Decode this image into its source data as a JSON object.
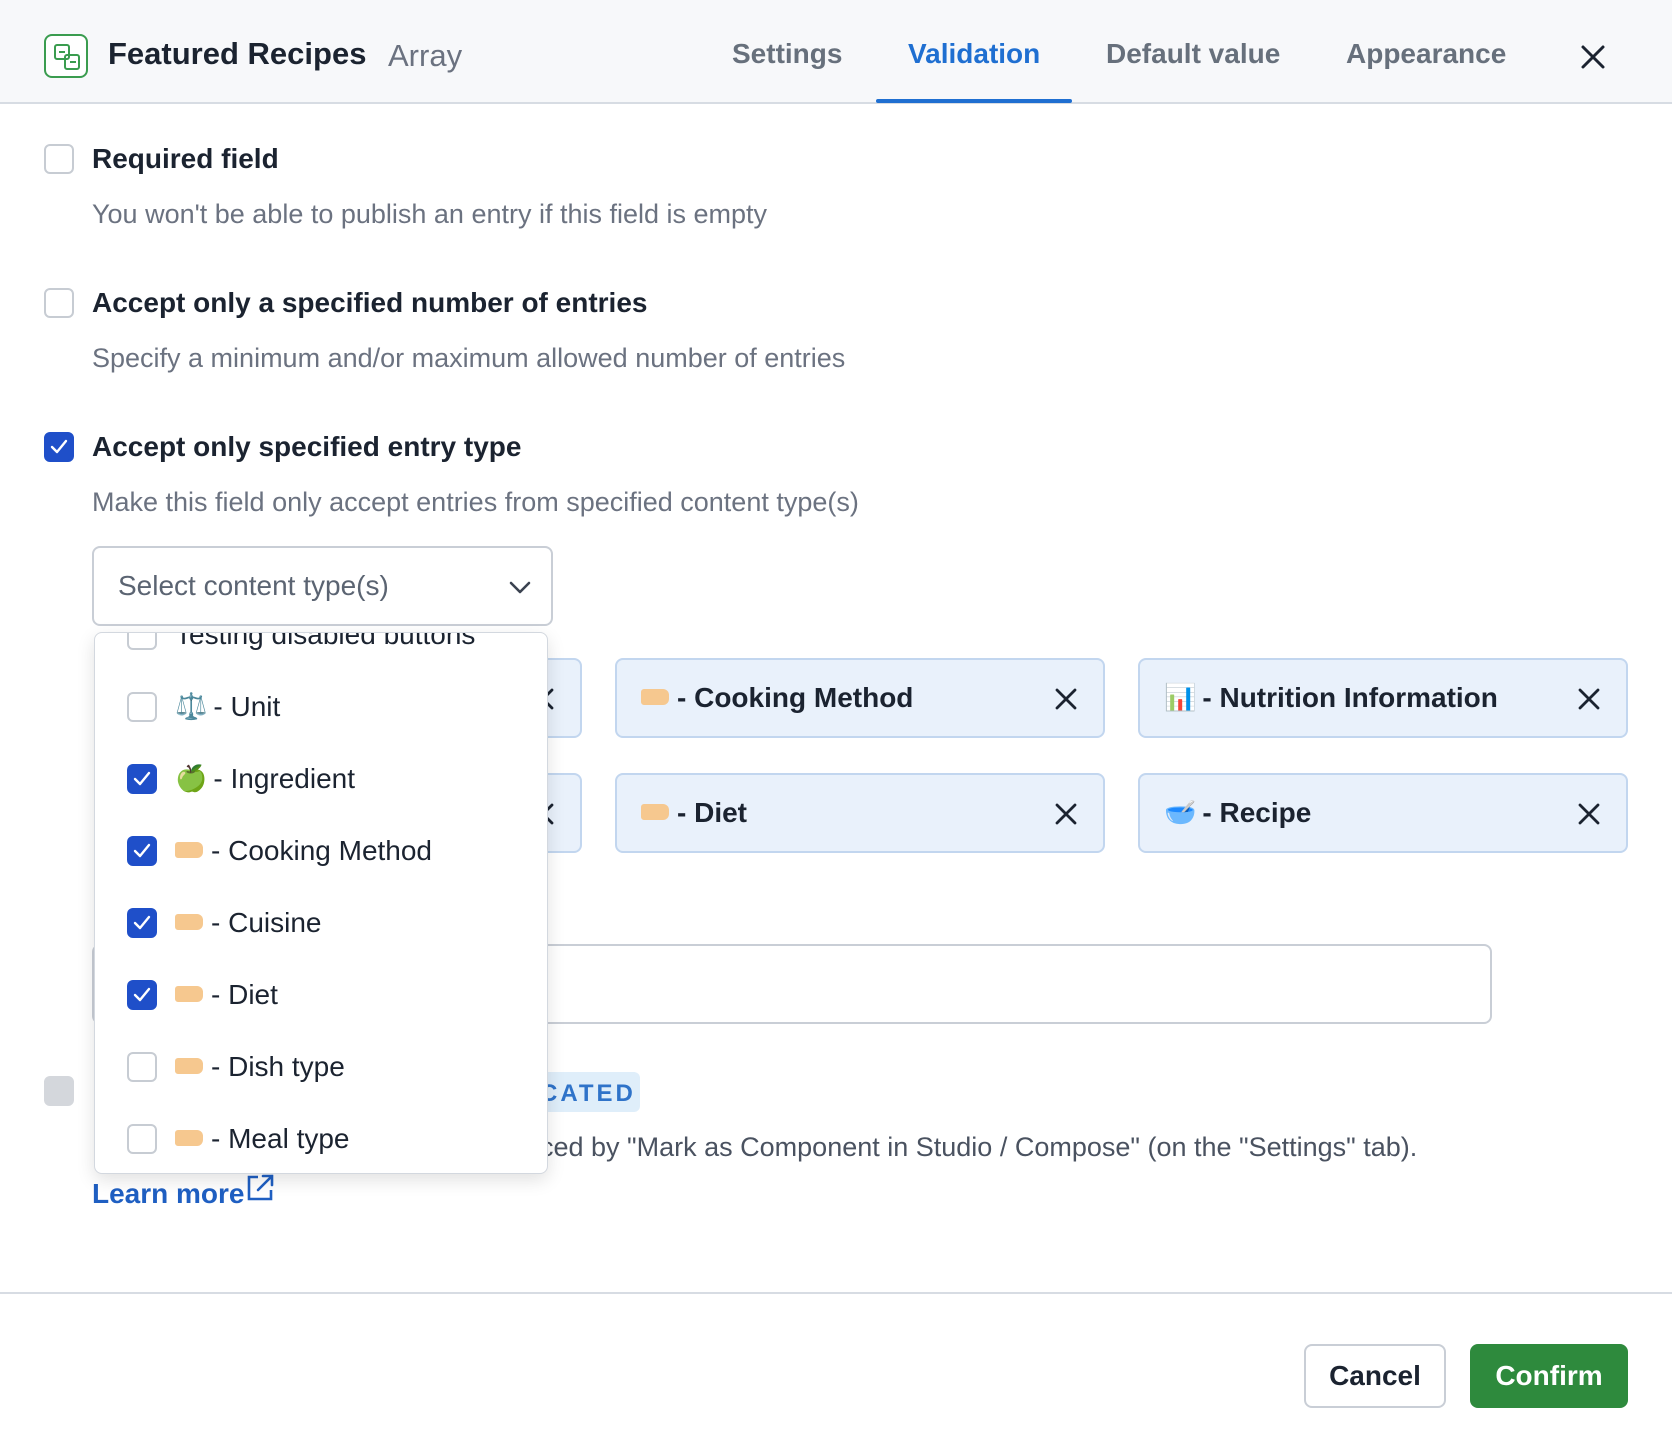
{
  "header": {
    "title": "Featured Recipes",
    "subtitle": "Array",
    "tabs": [
      {
        "label": "Settings",
        "active": false
      },
      {
        "label": "Validation",
        "active": true
      },
      {
        "label": "Default value",
        "active": false
      },
      {
        "label": "Appearance",
        "active": false
      }
    ],
    "close_icon": "close-icon"
  },
  "validations": [
    {
      "label": "Required field",
      "description": "You won't be able to publish an entry if this field is empty",
      "checked": false
    },
    {
      "label": "Accept only a specified number of entries",
      "description": "Specify a minimum and/or maximum allowed number of entries",
      "checked": false
    },
    {
      "label": "Accept only specified entry type",
      "description": "Make this field only accept entries from specified content type(s)",
      "checked": true
    }
  ],
  "content_type_select": {
    "placeholder": "Select content type(s)"
  },
  "dropdown": {
    "items": [
      {
        "label": "Testing disabled buttons",
        "checked": false,
        "icon": "none"
      },
      {
        "label": "- Unit",
        "emoji": "⚖️",
        "checked": false,
        "icon": "scale-icon"
      },
      {
        "label": "- Ingredient",
        "emoji": "🍏",
        "checked": true,
        "icon": "apple-icon"
      },
      {
        "label": "- Cooking Method",
        "checked": true,
        "icon": "tag-icon"
      },
      {
        "label": "- Cuisine",
        "checked": true,
        "icon": "tag-icon"
      },
      {
        "label": "- Diet",
        "checked": true,
        "icon": "tag-icon"
      },
      {
        "label": "- Dish type",
        "checked": false,
        "icon": "tag-icon"
      },
      {
        "label": "- Meal type",
        "checked": false,
        "icon": "tag-icon"
      }
    ]
  },
  "selected_chips": [
    {
      "label": "- Cooking Method",
      "icon": "tag-icon"
    },
    {
      "label": "- Nutrition Information",
      "emoji": "📊",
      "icon": "bar-chart-icon"
    },
    {
      "label": "- Diet",
      "icon": "tag-icon"
    },
    {
      "label": "- Recipe",
      "emoji": "🥣",
      "icon": "bowl-icon"
    }
  ],
  "deprecated": {
    "badge": "CATED",
    "description": "ced by \"Mark as Component in Studio / Compose\" (on the \"Settings\" tab).",
    "learn_more": "Learn more"
  },
  "footer": {
    "cancel_label": "Cancel",
    "confirm_label": "Confirm"
  },
  "colors": {
    "accent": "#1f6fd1",
    "checkbox_checked": "#1f4fc9",
    "confirm": "#2e8a3d",
    "chip_bg": "#e9f1fb"
  }
}
